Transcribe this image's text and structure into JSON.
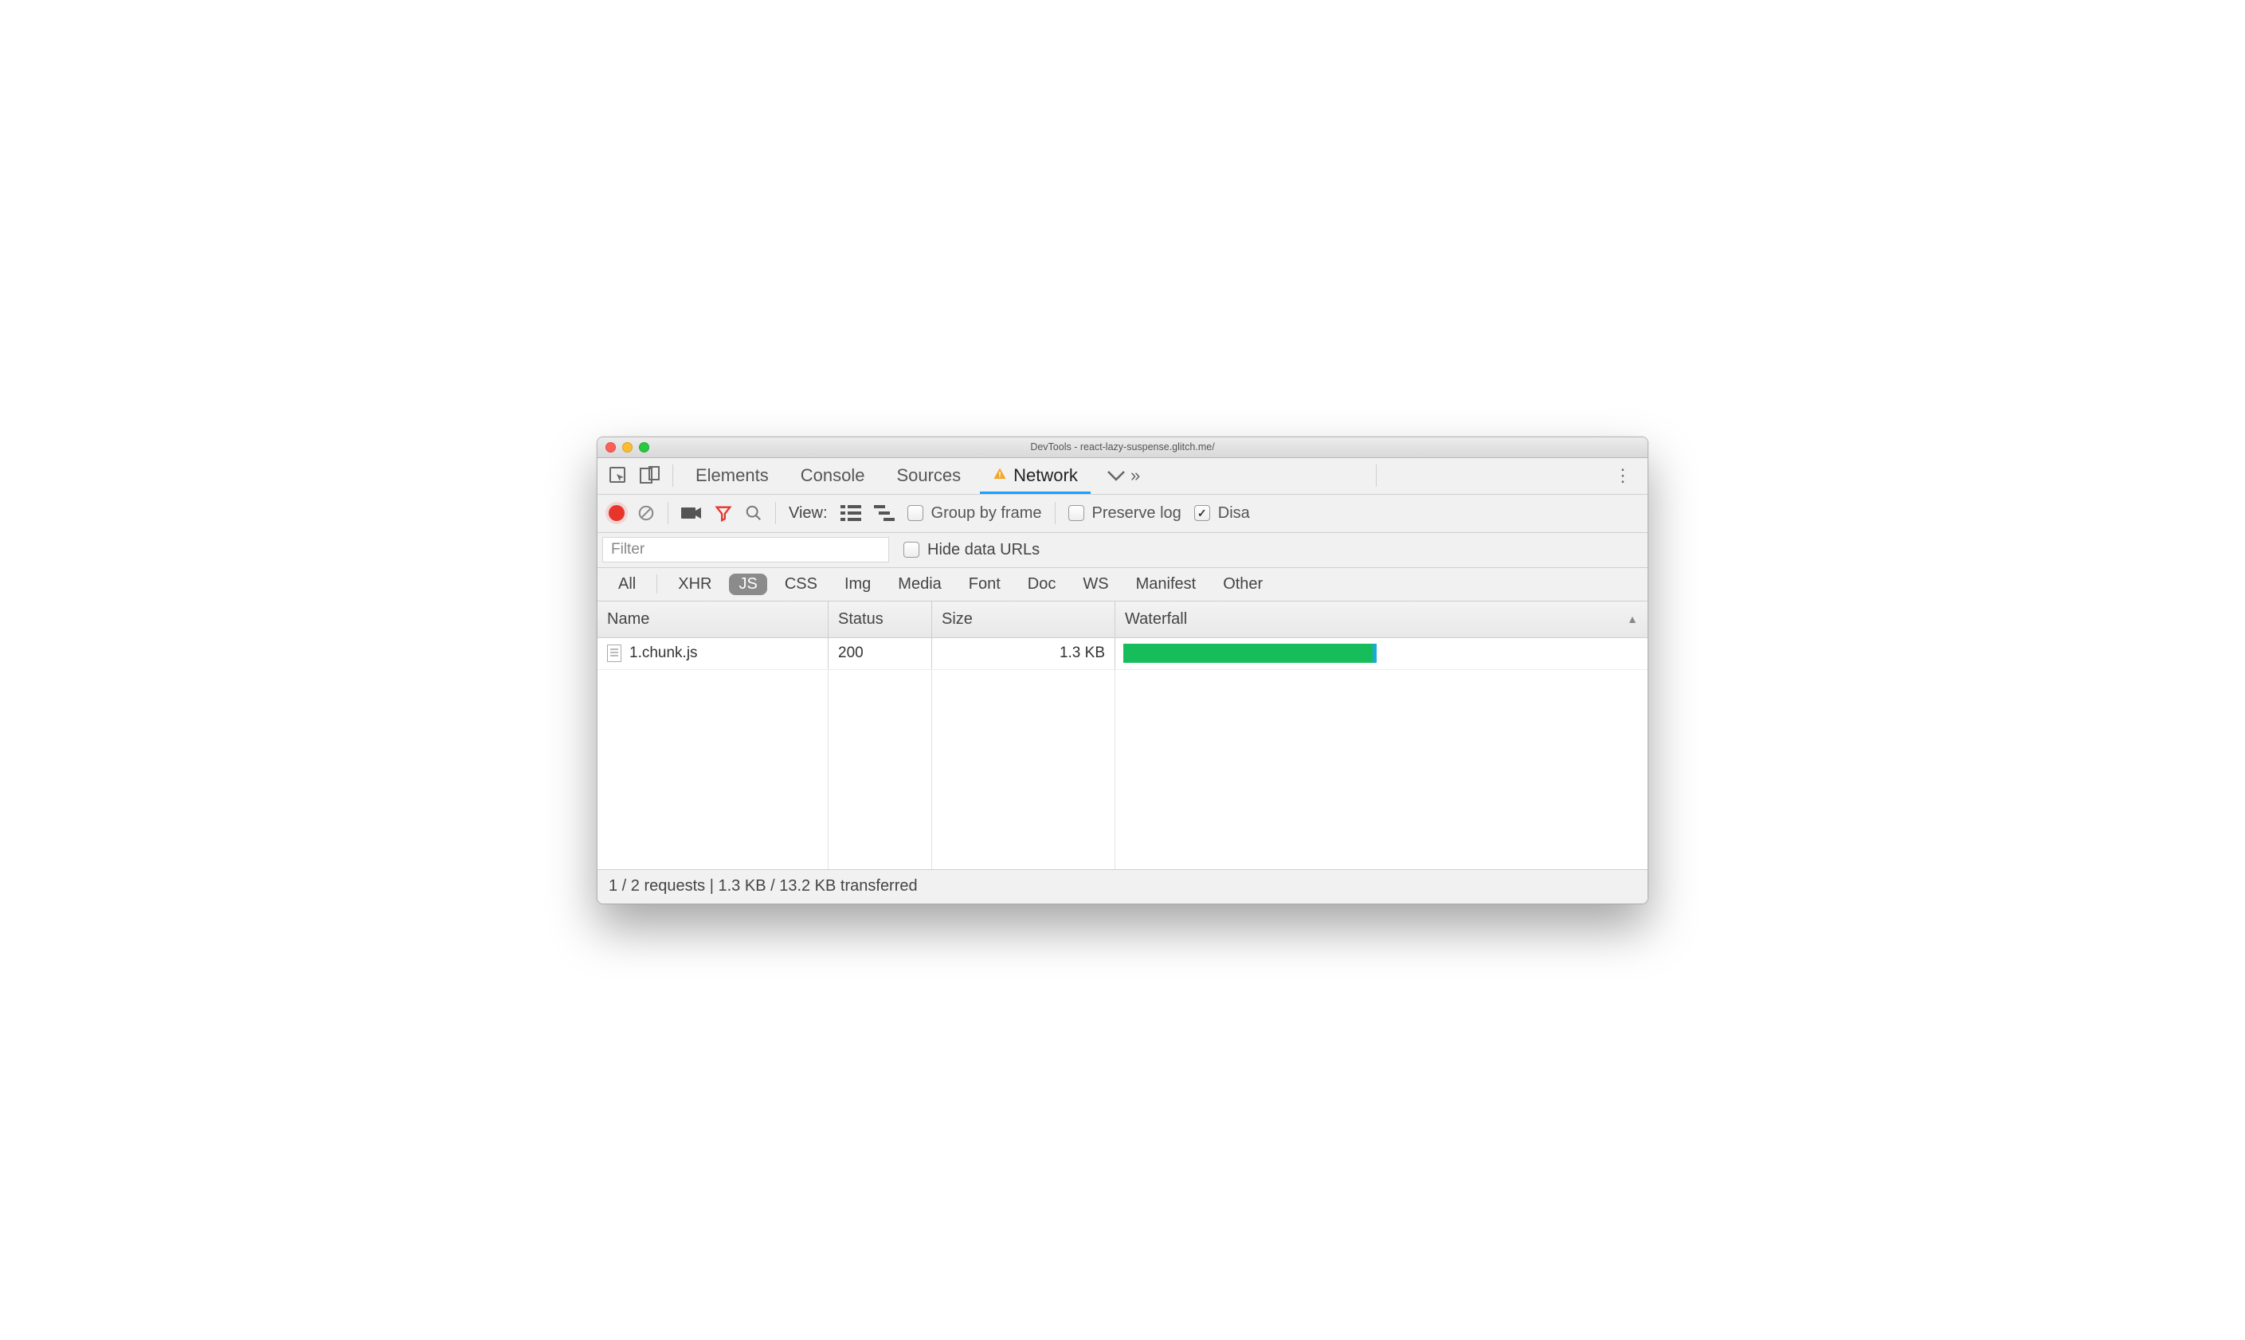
{
  "titlebar": {
    "title": "DevTools - react-lazy-suspense.glitch.me/"
  },
  "tabs": {
    "elements": "Elements",
    "console": "Console",
    "sources": "Sources",
    "network": "Network"
  },
  "toolbar": {
    "view_label": "View:",
    "group_by_frame": "Group by frame",
    "preserve_log": "Preserve log",
    "disable_cache": "Disa"
  },
  "filter": {
    "placeholder": "Filter",
    "hide_data_urls": "Hide data URLs"
  },
  "type_filters": [
    "All",
    "XHR",
    "JS",
    "CSS",
    "Img",
    "Media",
    "Font",
    "Doc",
    "WS",
    "Manifest",
    "Other"
  ],
  "active_type_filter": "JS",
  "table": {
    "headers": {
      "name": "Name",
      "status": "Status",
      "size": "Size",
      "waterfall": "Waterfall"
    },
    "rows": [
      {
        "name": "1.chunk.js",
        "status": "200",
        "size": "1.3 KB"
      }
    ]
  },
  "status_bar": "1 / 2 requests | 1.3 KB / 13.2 KB transferred"
}
